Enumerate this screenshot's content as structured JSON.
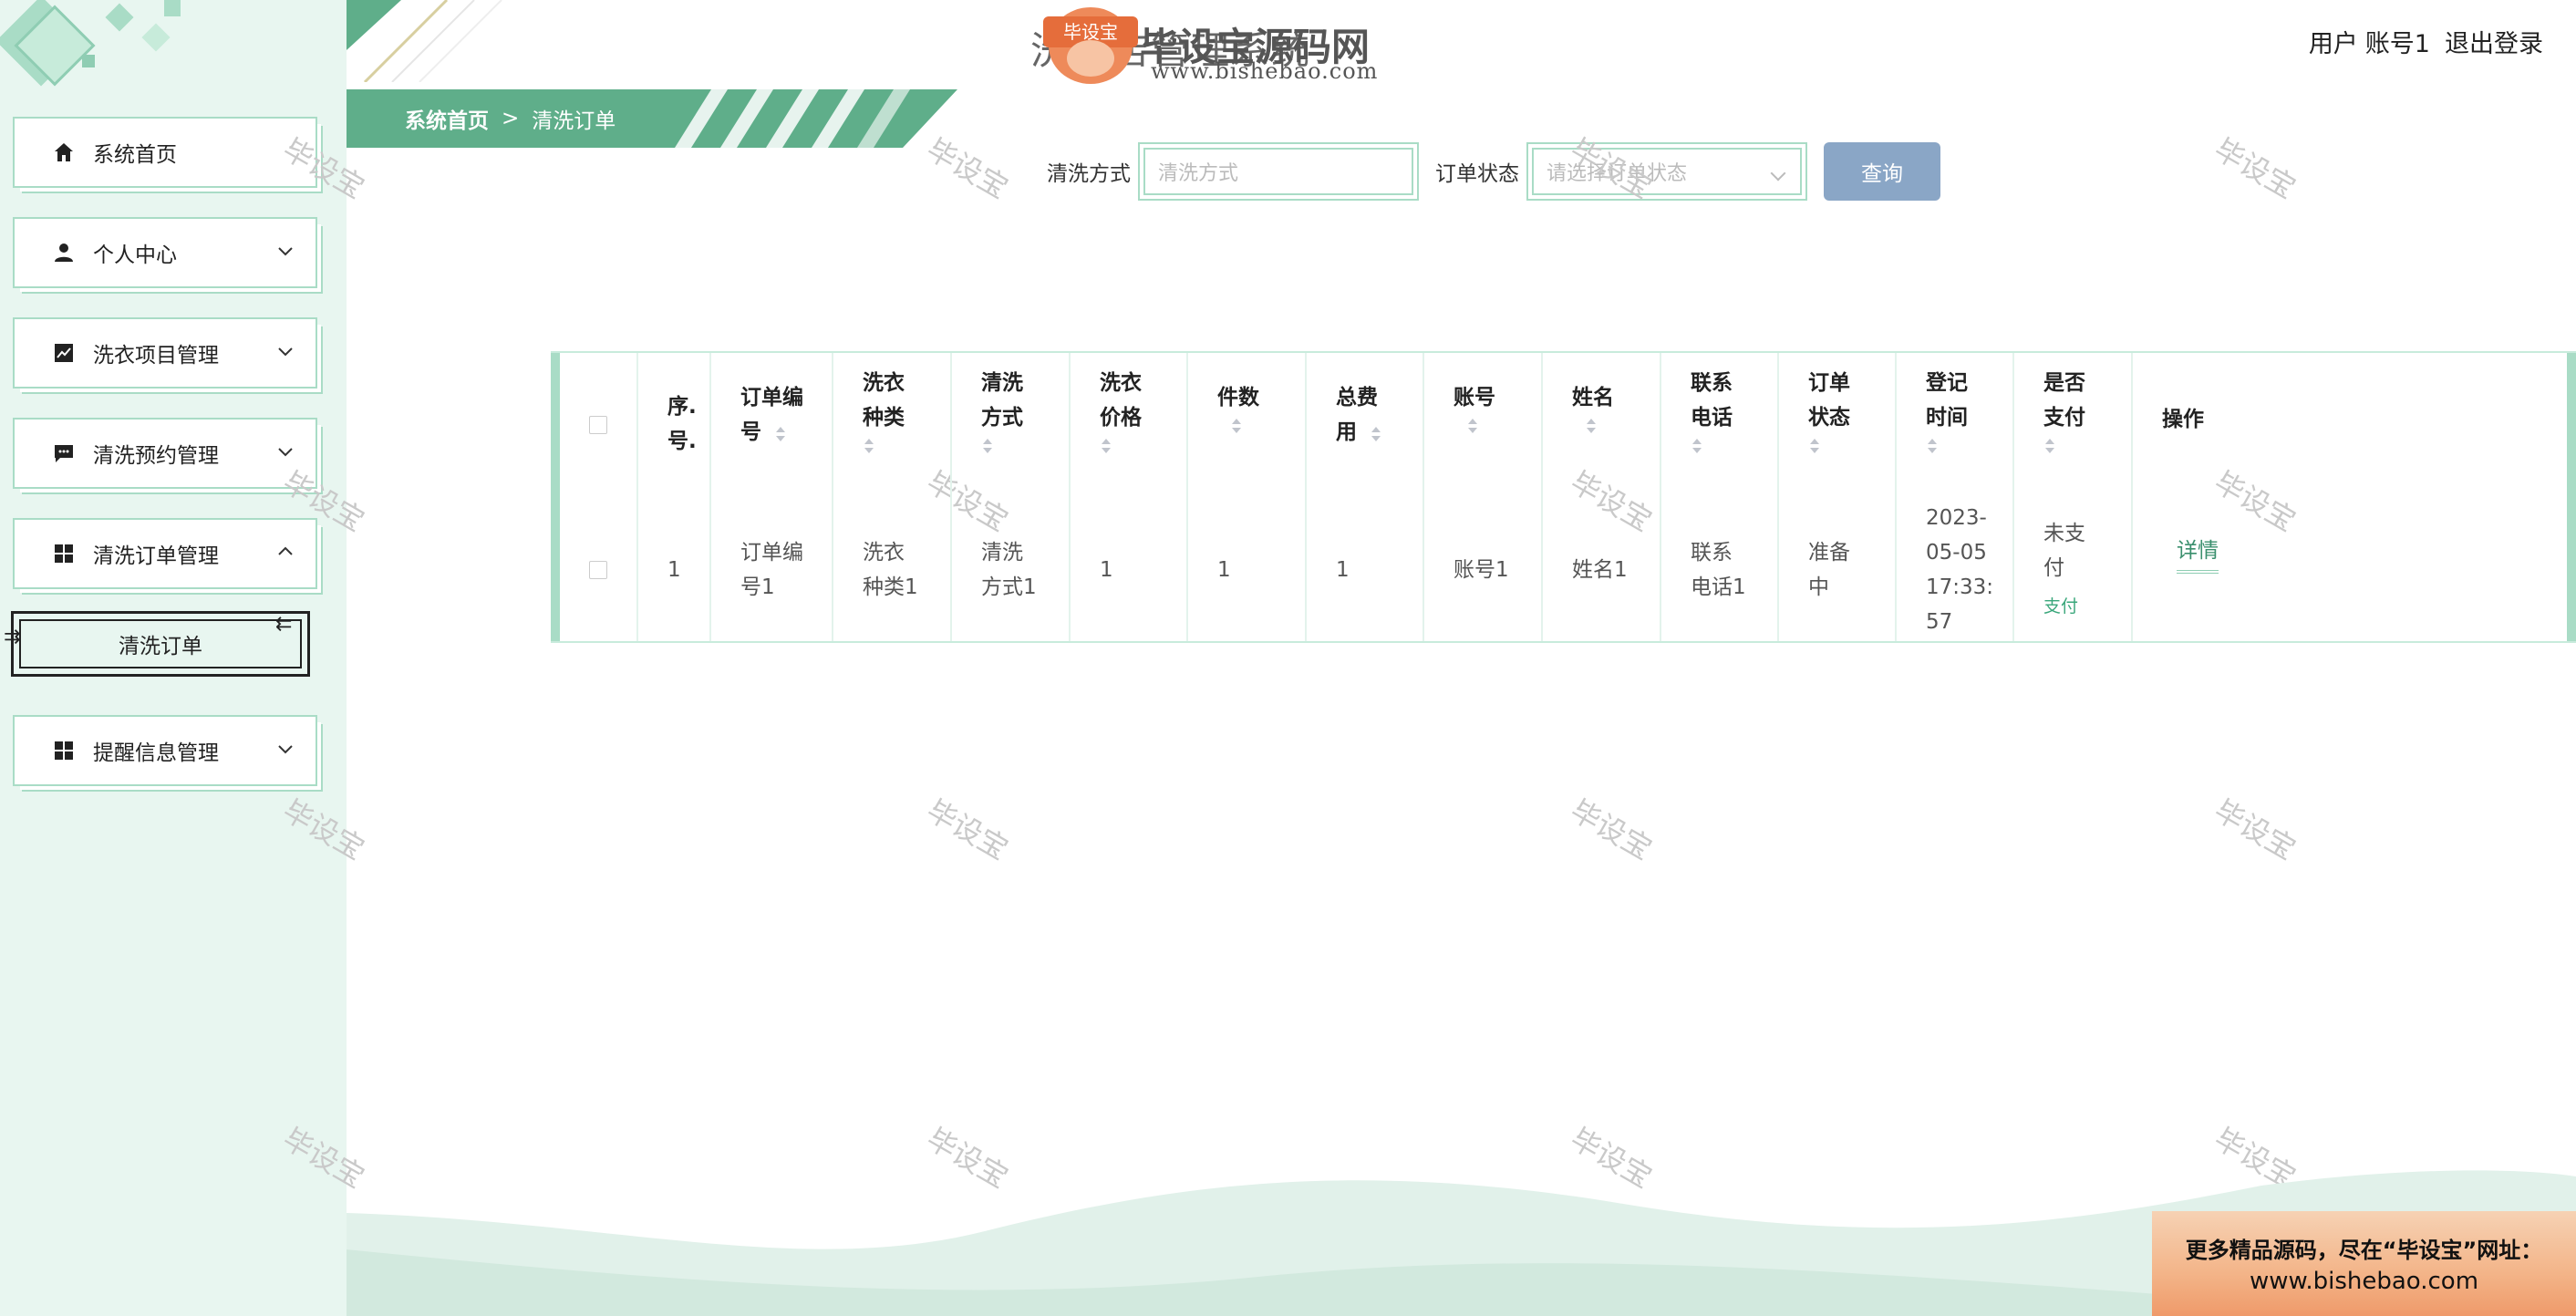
{
  "header": {
    "site_title": "洗衣店管理系统",
    "logo_text": "毕设宝",
    "watermark_brand": "毕设宝源码网",
    "watermark_url": "www.bishebao.com",
    "user_label": "用户",
    "user_name": "账号1",
    "logout_label": "退出登录"
  },
  "sidebar": {
    "items": [
      {
        "label": "系统首页",
        "icon": "home-icon"
      },
      {
        "label": "个人中心",
        "icon": "user-icon"
      },
      {
        "label": "洗衣项目管理",
        "icon": "chart-icon"
      },
      {
        "label": "清洗预约管理",
        "icon": "chat-icon"
      },
      {
        "label": "清洗订单管理",
        "icon": "grid-icon"
      },
      {
        "label": "提醒信息管理",
        "icon": "grid-icon"
      }
    ],
    "active_sub": "清洗订单"
  },
  "breadcrumb": {
    "home": "系统首页",
    "separator": ">",
    "current": "清洗订单"
  },
  "search": {
    "method_label": "清洗方式",
    "method_placeholder": "清洗方式",
    "status_label": "订单状态",
    "status_placeholder": "请选择订单状态",
    "query_button": "查询"
  },
  "table": {
    "headers": {
      "index": [
        "序.",
        "号."
      ],
      "order_no": [
        "订单编",
        "号"
      ],
      "type": [
        "洗衣",
        "种类"
      ],
      "method": [
        "清洗",
        "方式"
      ],
      "price": [
        "洗衣",
        "价格"
      ],
      "count": [
        "件数"
      ],
      "total": [
        "总费",
        "用"
      ],
      "account": [
        "账号"
      ],
      "name": [
        "姓名"
      ],
      "phone": [
        "联系",
        "电话"
      ],
      "status": [
        "订单",
        "状态"
      ],
      "time": [
        "登记",
        "时间"
      ],
      "paid": [
        "是否",
        "支付"
      ],
      "ops": [
        "操作"
      ]
    },
    "row": {
      "index": "1",
      "order_no": [
        "订单编",
        "号1"
      ],
      "type": [
        "洗衣",
        "种类1"
      ],
      "method": [
        "清洗",
        "方式1"
      ],
      "price": "1",
      "count": "1",
      "total": "1",
      "account": "账号1",
      "name": "姓名1",
      "phone": [
        "联系",
        "电话1"
      ],
      "status": [
        "准备",
        "中"
      ],
      "time": [
        "2023-",
        "05-05",
        "17:33:",
        "57"
      ],
      "paid": [
        "未支",
        "付"
      ],
      "pay_link": "支付",
      "detail": "详情"
    }
  },
  "watermark_text": "毕设宝",
  "promo": {
    "line1": "更多精品源码，尽在“毕设宝”网址：",
    "line2": "www.bishebao.com"
  },
  "colors": {
    "accent": "#5fae8a",
    "sidebar_bg": "#e8f6f0",
    "border": "#a9dcc6",
    "query_button": "#8aa6c6"
  }
}
